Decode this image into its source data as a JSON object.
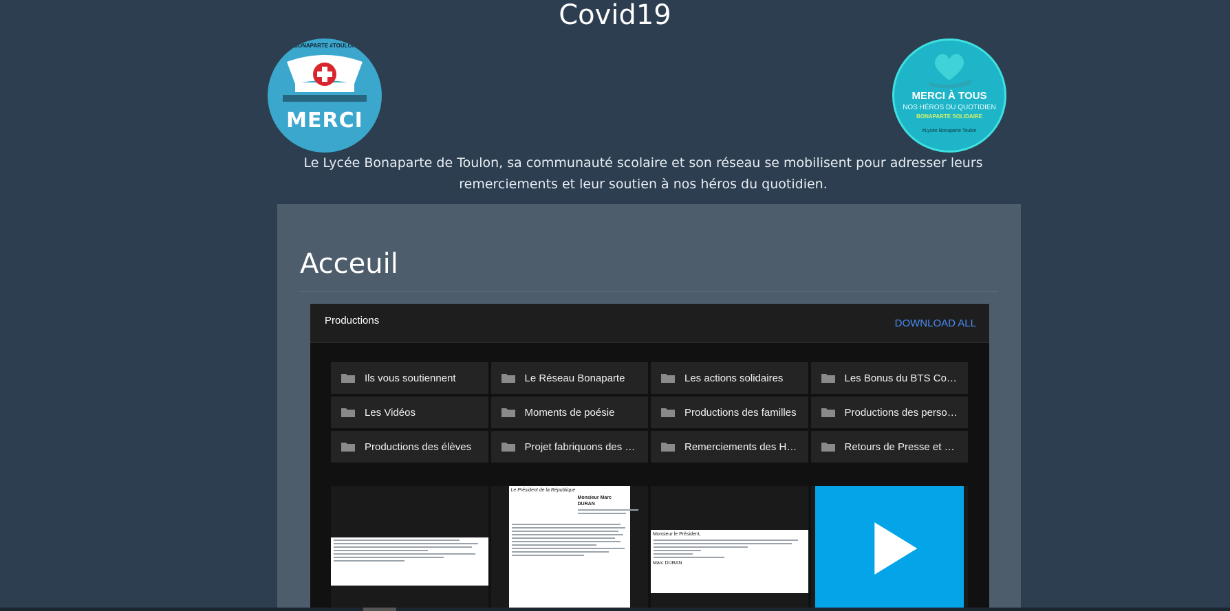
{
  "site": {
    "title": "Covid19",
    "intro": "Le Lycée Bonaparte de Toulon, sa communauté scolaire et son réseau se mobilisent pour adresser leurs remerciements et leur soutien à nos héros du quotidien."
  },
  "logos": {
    "left": {
      "ring_text": "#LYCEEBONAPARTE #TOULON #HERO",
      "main": "MERCI",
      "icon": "first-aid-icon"
    },
    "right": {
      "line1": "MERCI À TOUS",
      "line2": "NOS HÉROS DU QUOTIDIEN",
      "line3": "BONAPARTE SOLIDAIRE",
      "line4": "#Lycée Bonaparte Toulon",
      "icon": "heart-hand-icon"
    }
  },
  "page": {
    "heading": "Acceuil"
  },
  "drive": {
    "title": "Productions",
    "download_all": "DOWNLOAD ALL",
    "folders": [
      {
        "label": "Ils vous soutiennent"
      },
      {
        "label": "Le Réseau Bonaparte"
      },
      {
        "label": "Les actions solidaires"
      },
      {
        "label": "Les Bonus du BTS Com..."
      },
      {
        "label": "Les Vidéos"
      },
      {
        "label": "Moments de poésie"
      },
      {
        "label": "Productions des familles"
      },
      {
        "label": "Productions des personn..."
      },
      {
        "label": "Productions des élèves"
      },
      {
        "label": "Projet fabriquons des ma..."
      },
      {
        "label": "Remerciements des Hér..."
      },
      {
        "label": "Retours de Presse et co..."
      }
    ],
    "thumbs": {
      "letter_greeting": "Monsieur le Président,",
      "letter_sign": "Marc DURAN",
      "letter2_header": "Le Président de la République",
      "letter2_recipient": "Monsieur Marc DURAN"
    }
  },
  "colors": {
    "background": "#2c3e50",
    "panel": "#4e5d6c",
    "accent_link": "#4a8cf7",
    "video": "#04a4e8"
  }
}
